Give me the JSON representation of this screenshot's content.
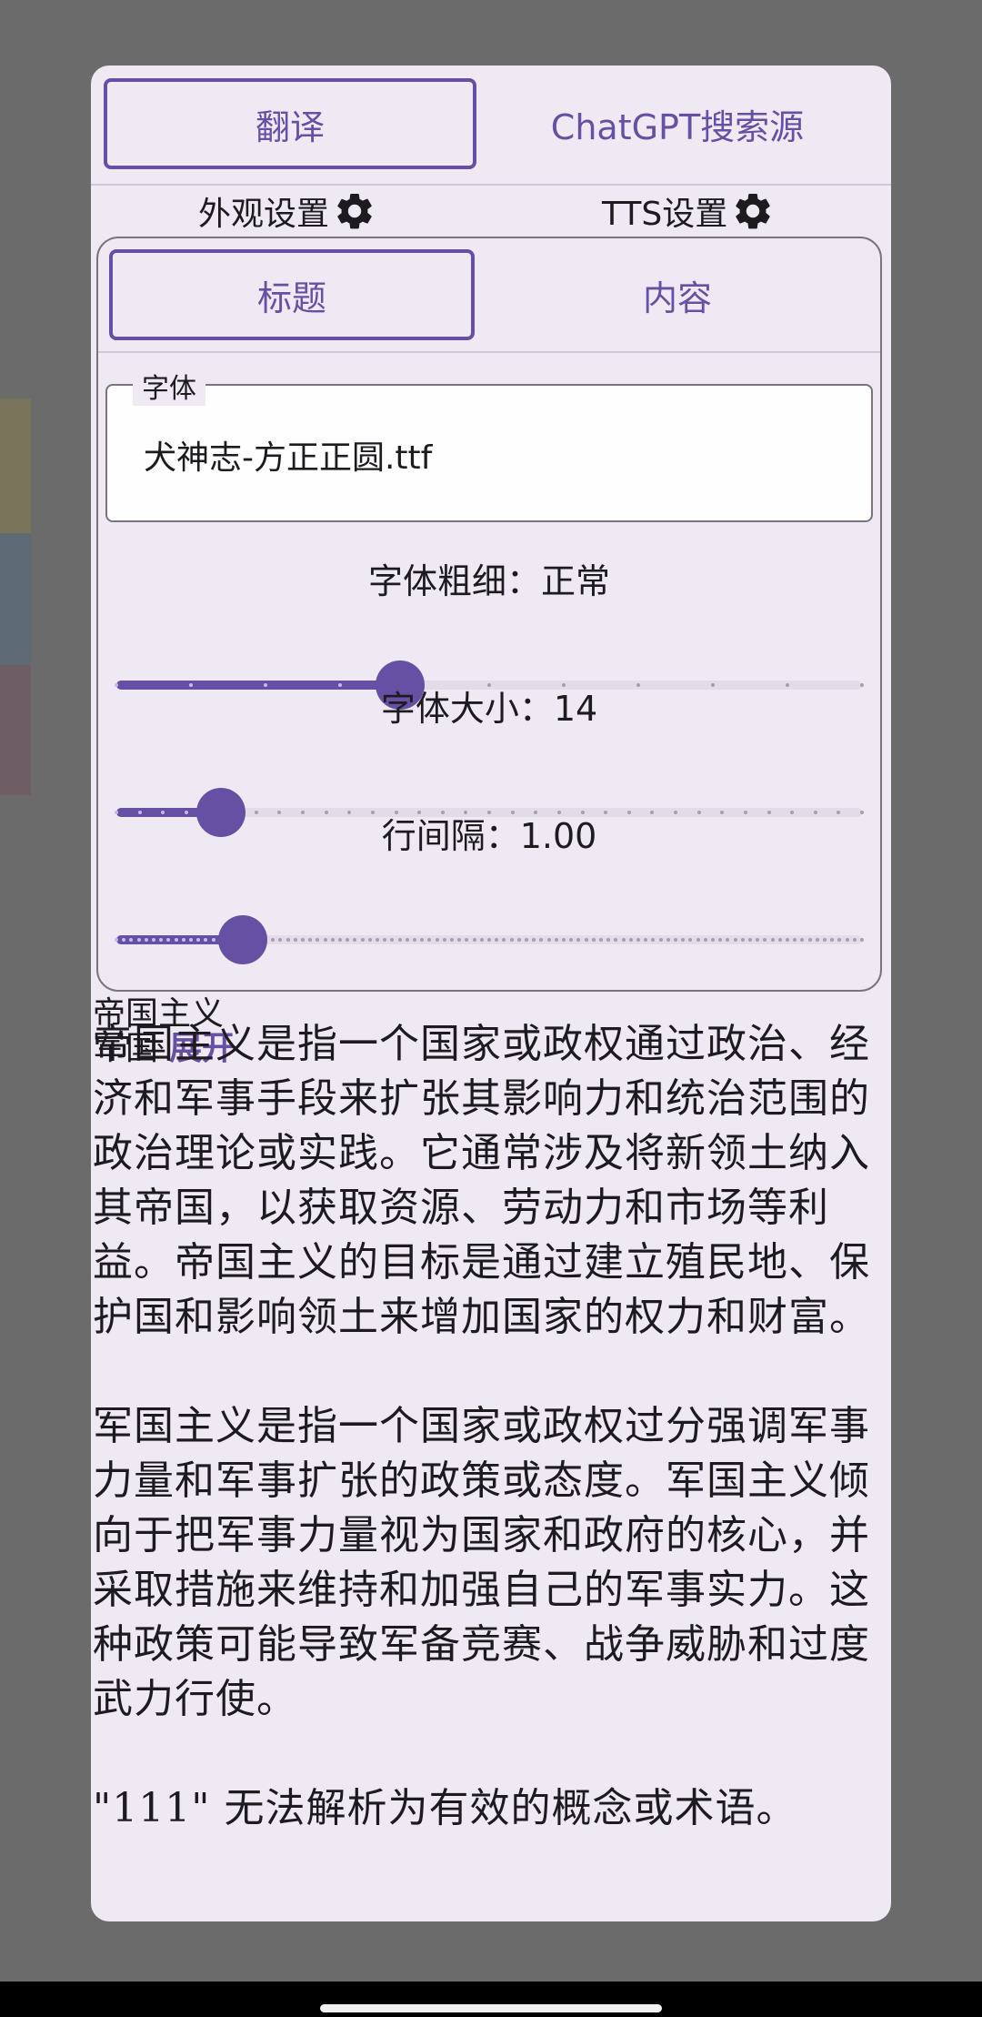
{
  "top_tabs": {
    "active": "翻译",
    "inactive": "ChatGPT搜索源"
  },
  "settings": {
    "appearance": "外观设置",
    "tts": "TTS设置"
  },
  "panel_tabs": {
    "active": "标题",
    "inactive": "内容"
  },
  "font_field": {
    "label": "字体",
    "value": "犬神志-方正正圆.ttf"
  },
  "sliders": {
    "weight": {
      "label": "字体粗细：正常",
      "fraction": 0.38,
      "steps": 10
    },
    "size": {
      "label": "字体大小：14",
      "fraction": 0.14,
      "steps": 32
    },
    "line_spacing": {
      "label": "行间隔：1.00",
      "fraction": 0.17,
      "steps": 100
    }
  },
  "result": {
    "title_line1": "帝国主义",
    "title_line2": "军国",
    "expand_label": "展开",
    "paragraph1": "帝国主义是指一个国家或政权通过政治、经济和军事手段来扩张其影响力和统治范围的政治理论或实践。它通常涉及将新领土纳入其帝国，以获取资源、劳动力和市场等利益。帝国主义的目标是通过建立殖民地、保护国和影响领土来增加国家的权力和财富。",
    "paragraph2": "军国主义是指一个国家或政权过分强调军事力量和军事扩张的政策或态度。军国主义倾向于把军事力量视为国家和政府的核心，并采取措施来维持和加强自己的军事实力。这种政策可能导致军备竞赛、战争威胁和过度武力行使。",
    "paragraph3": "\"111\" 无法解析为有效的概念或术语。"
  },
  "colors": {
    "accent": "#6650a4",
    "background": "#efe9f3",
    "scrim": "#6b6b6b"
  }
}
